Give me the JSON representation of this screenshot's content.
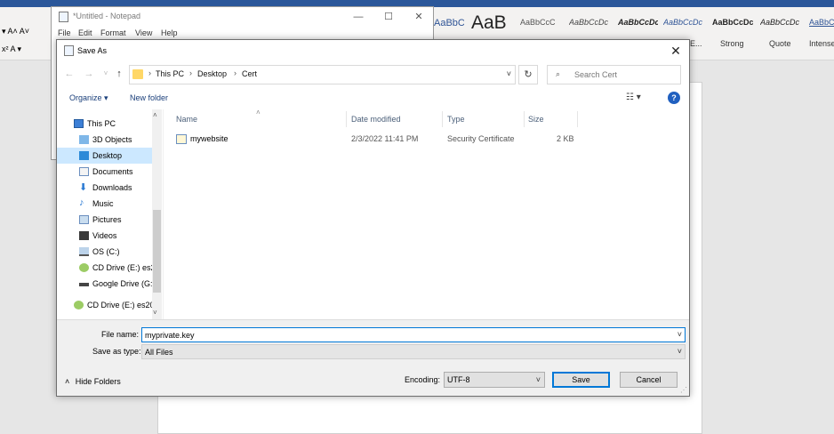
{
  "word": {
    "styles": [
      {
        "sample": "AaBbCcD",
        "name": ""
      },
      {
        "sample": "AaB",
        "name": ""
      },
      {
        "sample": "AaBbCcC",
        "name": ""
      },
      {
        "sample": "AaBbCcDc",
        "name": ""
      },
      {
        "sample": "AaBbCcDc",
        "name": ""
      },
      {
        "sample": "AaBbCcDc",
        "name": ""
      },
      {
        "sample": "AaBbCcDc",
        "name": "Strong"
      },
      {
        "sample": "AaBbCcDc",
        "name": "Quote"
      },
      {
        "sample": "AaBbC",
        "name": "Intense"
      }
    ],
    "partial_style_name": "E..."
  },
  "notepad": {
    "title": "*Untitled - Notepad",
    "menu": [
      "File",
      "Edit",
      "Format",
      "View",
      "Help"
    ]
  },
  "dialog": {
    "title": "Save As",
    "breadcrumb": [
      "This PC",
      "Desktop",
      "Cert"
    ],
    "search_placeholder": "Search Cert",
    "toolbar": {
      "organize": "Organize ▾",
      "new_folder": "New folder"
    },
    "nav_items": [
      {
        "label": "This PC",
        "icon": "computer-icon"
      },
      {
        "label": "3D Objects",
        "icon": "cube-icon"
      },
      {
        "label": "Desktop",
        "icon": "desktop-icon"
      },
      {
        "label": "Documents",
        "icon": "document-icon"
      },
      {
        "label": "Downloads",
        "icon": "download-icon"
      },
      {
        "label": "Music",
        "icon": "music-icon"
      },
      {
        "label": "Pictures",
        "icon": "picture-icon"
      },
      {
        "label": "Videos",
        "icon": "video-icon"
      },
      {
        "label": "OS (C:)",
        "icon": "drive-icon"
      },
      {
        "label": "CD Drive (E:) es2",
        "icon": "cd-drive-icon"
      },
      {
        "label": "Google Drive (G:",
        "icon": "drive-icon"
      },
      {
        "label": "CD Drive (E:) es20",
        "icon": "cd-drive-icon"
      }
    ],
    "columns": {
      "name": "Name",
      "date": "Date modified",
      "type": "Type",
      "size": "Size"
    },
    "files": [
      {
        "name": "mywebsite",
        "date": "2/3/2022 11:41 PM",
        "type": "Security Certificate",
        "size": "2 KB"
      }
    ],
    "file_name_label": "File name:",
    "file_name_value": "myprivate.key",
    "save_as_type_label": "Save as type:",
    "save_as_type_value": "All Files",
    "hide_folders": "Hide Folders",
    "encoding_label": "Encoding:",
    "encoding_value": "UTF-8",
    "save": "Save",
    "cancel": "Cancel"
  },
  "colors": {
    "accent": "#0078d7",
    "selection": "#cce8ff",
    "word_blue": "#2b579a"
  }
}
